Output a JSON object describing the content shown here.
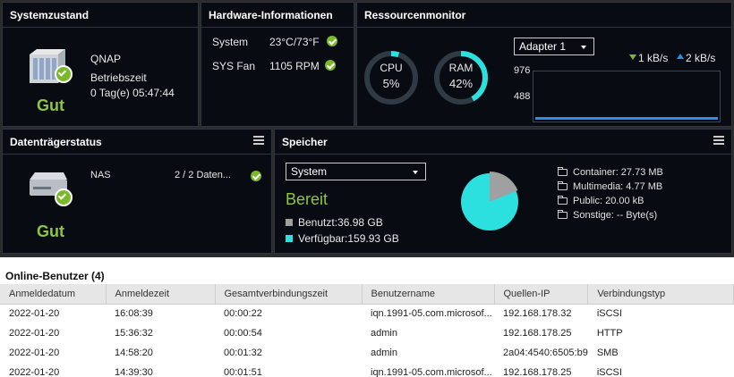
{
  "system": {
    "title": "Systemzustand",
    "name": "QNAP",
    "uptime_label": "Betriebszeit",
    "uptime": "0 Tag(e) 05:47:44",
    "status": "Gut"
  },
  "hardware": {
    "title": "Hardware-Informationen",
    "rows": [
      {
        "label": "System",
        "value": "23°C/73°F"
      },
      {
        "label": "SYS Fan",
        "value": "1105 RPM"
      }
    ]
  },
  "resource": {
    "title": "Ressourcenmonitor",
    "cpu_label": "CPU",
    "cpu_value": "5%",
    "cpu_percent": 5,
    "ram_label": "RAM",
    "ram_value": "42%",
    "ram_percent": 42,
    "adapter": "Adapter 1",
    "download": "1 kB/s",
    "upload": "2 kB/s",
    "tick_high": "976",
    "tick_mid": "488"
  },
  "disk": {
    "title": "Datenträgerstatus",
    "name": "NAS",
    "count": "2 / 2 Daten...",
    "status": "Gut"
  },
  "storage": {
    "title": "Speicher",
    "select": "System",
    "state": "Bereit",
    "used": "Benutzt:36.98 GB",
    "free": "Verfügbar:159.93 GB",
    "used_gb": 36.98,
    "free_gb": 159.93,
    "items": [
      "Container: 27.73 MB",
      "Multimedia: 4.77 MB",
      "Public: 20.00 kB",
      "Sonstige: -- Byte(s)"
    ],
    "colors": {
      "used": "#a0a0a0",
      "free": "#2de0e0"
    }
  },
  "users": {
    "title": "Online-Benutzer (4)",
    "columns": [
      "Anmeldedatum",
      "Anmeldezeit",
      "Gesamtverbindungszeit",
      "Benutzername",
      "Quellen-IP",
      "Verbindungstyp"
    ],
    "rows": [
      [
        "2022-01-20",
        "16:08:39",
        "00:00:22",
        "iqn.1991-05.com.microsof...",
        "192.168.178.32",
        "iSCSI"
      ],
      [
        "2022-01-20",
        "15:36:32",
        "00:00:54",
        "admin",
        "192.168.178.25",
        "HTTP"
      ],
      [
        "2022-01-20",
        "14:58:20",
        "00:01:32",
        "admin",
        "2a04:4540:6505:b9",
        "SMB"
      ],
      [
        "2022-01-20",
        "14:39:30",
        "00:01:51",
        "iqn.1991-05.com.microsof...",
        "192.168.178.25",
        "iSCSI"
      ]
    ]
  },
  "colors": {
    "accent": "#2de0e0",
    "ok": "#7ab929",
    "gut": "#8dc63f"
  }
}
